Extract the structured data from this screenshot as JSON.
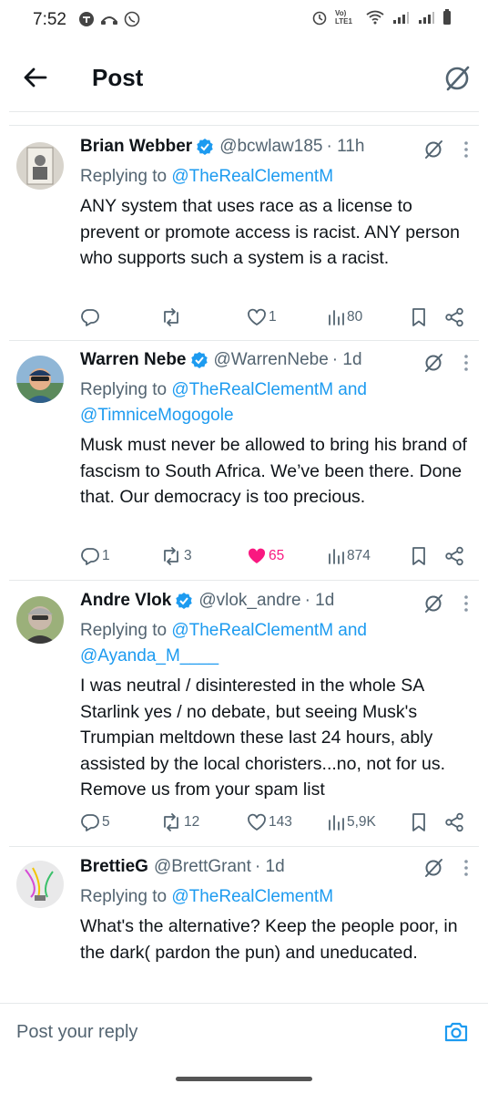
{
  "status_bar": {
    "time": "7:52",
    "network_label": "Vo) LTE1"
  },
  "header": {
    "title": "Post"
  },
  "replies": [
    {
      "name": "Brian Webber",
      "handle": "@bcwlaw185",
      "time": "· 11h",
      "replying_prefix": "Replying to ",
      "mentions": "@TheRealClementM",
      "mentions_line2": "",
      "text": "ANY system that uses race as a license to prevent or promote access is racist. ANY person who supports such a system is a racist.",
      "reply_count": "",
      "repost_count": "",
      "like_count": "1",
      "view_count": "80",
      "liked": false
    },
    {
      "name": "Warren Nebe",
      "handle": "@WarrenNebe",
      "time": "· 1d",
      "replying_prefix": "Replying to ",
      "mentions": "@TheRealClementM and",
      "mentions_line2": "@TimniceMogogole",
      "text": "Musk must never be allowed to bring his brand of fascism to South Africa. We’ve been there. Done that. Our democracy is too precious.",
      "reply_count": "1",
      "repost_count": "3",
      "like_count": "65",
      "view_count": "874",
      "liked": true
    },
    {
      "name": "Andre Vlok",
      "handle": "@vlok_andre",
      "time": "· 1d",
      "replying_prefix": "Replying to ",
      "mentions": "@TheRealClementM and",
      "mentions_line2": "@Ayanda_M____",
      "text": "I was neutral / disinterested in the whole SA Starlink yes / no debate, but seeing Musk's Trumpian meltdown these last 24 hours, ably assisted by the local choristers...no, not for us. Remove us from your spam list",
      "reply_count": "5",
      "repost_count": "12",
      "like_count": "143",
      "view_count": "5,9K",
      "liked": false
    },
    {
      "name": "BrettieG",
      "handle": "@BrettGrant",
      "time": "· 1d",
      "replying_prefix": "Replying to ",
      "mentions": "@TheRealClementM",
      "mentions_line2": "",
      "text": "What's the alternative? Keep the people poor, in the dark( pardon the pun) and uneducated.",
      "reply_count": "",
      "repost_count": "",
      "like_count": "",
      "view_count": "",
      "liked": false
    }
  ],
  "composer": {
    "placeholder": "Post your reply"
  },
  "colors": {
    "accent": "#1d9bf0",
    "like": "#f91880",
    "muted": "#536471",
    "text": "#0f1419"
  }
}
